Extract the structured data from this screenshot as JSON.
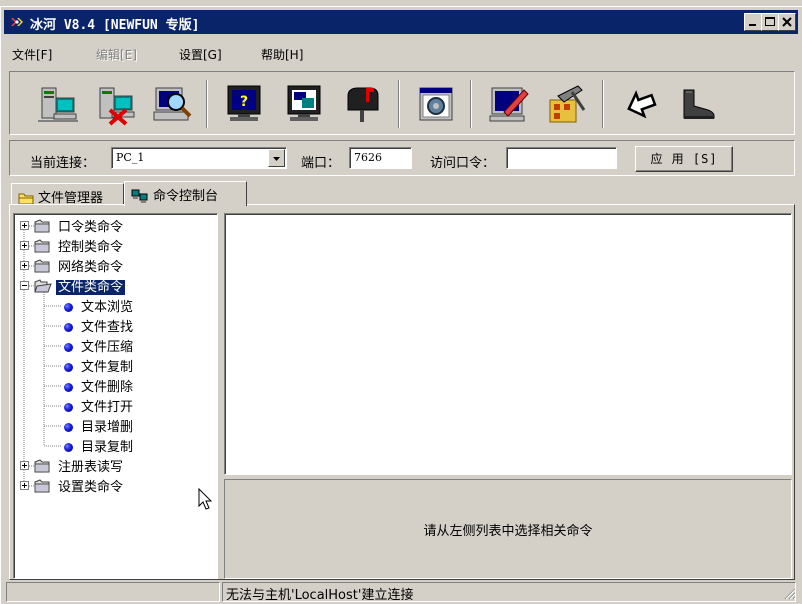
{
  "window": {
    "title": "冰河 V8.4 [NEWFUN 专版]"
  },
  "menu": [
    {
      "label": "文件[F]",
      "enabled": true
    },
    {
      "label": "编辑[E]",
      "enabled": false
    },
    {
      "label": "设置[G]",
      "enabled": true
    },
    {
      "label": "帮助[H]",
      "enabled": true
    }
  ],
  "toolbar": {
    "buttons": [
      {
        "icon": "add-host-icon"
      },
      {
        "icon": "delete-host-icon"
      },
      {
        "icon": "search-host-icon"
      },
      {
        "icon": "help-monitor-icon"
      },
      {
        "icon": "screen-monitor-icon"
      },
      {
        "icon": "mailbox-icon"
      },
      {
        "icon": "settings-window-icon"
      },
      {
        "icon": "edit-monitor-icon"
      },
      {
        "icon": "tools-icon"
      },
      {
        "icon": "home-arrow-icon"
      },
      {
        "icon": "boot-icon"
      }
    ]
  },
  "connection": {
    "current_label": "当前连接：",
    "current_value": "PC_1",
    "port_label": "端口：",
    "port_value": "7626",
    "password_label": "访问口令：",
    "password_value": "",
    "apply_label": "应 用 [S]"
  },
  "tabs": [
    {
      "label": "文件管理器",
      "active": false
    },
    {
      "label": "命令控制台",
      "active": true
    }
  ],
  "tree": {
    "groups": [
      {
        "label": "口令类命令",
        "expanded": false
      },
      {
        "label": "控制类命令",
        "expanded": false
      },
      {
        "label": "网络类命令",
        "expanded": false
      },
      {
        "label": "文件类命令",
        "expanded": true,
        "selected": true,
        "children": [
          "文本浏览",
          "文件查找",
          "文件压缩",
          "文件复制",
          "文件删除",
          "文件打开",
          "目录增删",
          "目录复制"
        ]
      },
      {
        "label": "注册表读写",
        "expanded": false
      },
      {
        "label": "设置类命令",
        "expanded": false
      }
    ]
  },
  "hint": "请从左侧列表中选择相关命令",
  "status": {
    "message": "无法与主机'LocalHost'建立连接"
  },
  "colors": {
    "titlebar": "#0a246a",
    "face": "#d4d0c8",
    "selection": "#0a246a"
  }
}
